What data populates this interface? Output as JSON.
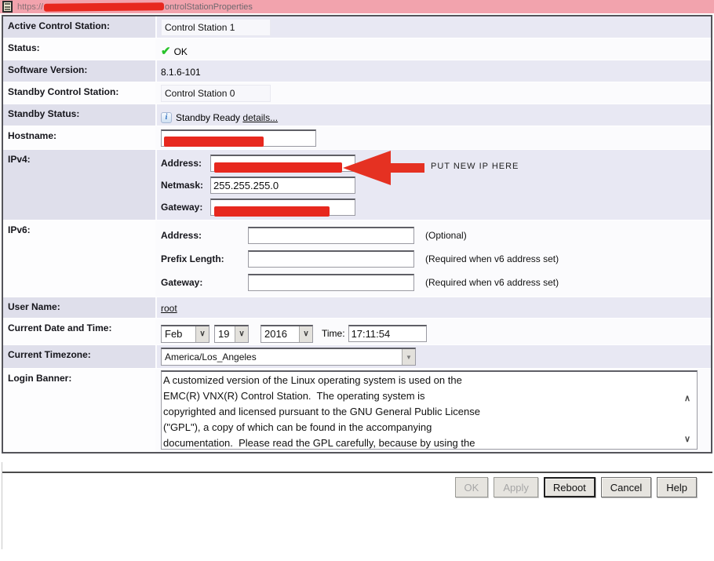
{
  "titlebar": {
    "url_prefix": "https://",
    "url_suffix": "ontrolStationProperties"
  },
  "fields": {
    "active": {
      "label": "Active Control Station:",
      "value": "Control Station 1"
    },
    "status": {
      "label": "Status:",
      "value": "OK"
    },
    "version": {
      "label": "Software Version:",
      "value": "8.1.6-101"
    },
    "standby": {
      "label": "Standby Control Station:",
      "value": "Control Station 0"
    },
    "standby_status": {
      "label": "Standby Status:",
      "value": "Standby Ready",
      "link": "details..."
    },
    "hostname": {
      "label": "Hostname:"
    },
    "ipv4": {
      "label": "IPv4:",
      "address_label": "Address:",
      "netmask_label": "Netmask:",
      "netmask_value": "255.255.255.0",
      "gateway_label": "Gateway:"
    },
    "ipv6": {
      "label": "IPv6:",
      "address_label": "Address:",
      "address_note": "(Optional)",
      "prefix_label": "Prefix Length:",
      "prefix_note": "(Required when v6 address set)",
      "gateway_label": "Gateway:",
      "gateway_note": "(Required when v6 address set)"
    },
    "user": {
      "label": "User Name:",
      "value": "root"
    },
    "datetime": {
      "label": "Current Date and Time:",
      "month": "Feb",
      "day": "19",
      "year": "2016",
      "time_label": "Time:",
      "time_value": "17:11:54"
    },
    "timezone": {
      "label": "Current Timezone:",
      "value": "America/Los_Angeles"
    },
    "banner": {
      "label": "Login Banner:",
      "text": "A customized version of the Linux operating system is used on the\nEMC(R) VNX(R) Control Station.  The operating system is\ncopyrighted and licensed pursuant to the GNU General Public License\n(\"GPL\"), a copy of which can be found in the accompanying\ndocumentation.  Please read the GPL carefully, because by using the"
    }
  },
  "annotation": {
    "text": "PUT NEW IP HERE"
  },
  "buttons": {
    "ok": "OK",
    "apply": "Apply",
    "reboot": "Reboot",
    "cancel": "Cancel",
    "help": "Help"
  },
  "icons": {
    "check": "✔",
    "info": "i",
    "select_chevron": "∨",
    "dropdown_arrow": "▼",
    "scroll_up": "∧",
    "scroll_down": "∨"
  },
  "colors": {
    "titlebar_pink": "#f2a3ad",
    "redaction_red": "#e7281e",
    "arrow_red": "#e53122",
    "stripe_lavender": "#e8e8f3",
    "check_green": "#29c32b",
    "info_blue": "#2b6cbe"
  }
}
